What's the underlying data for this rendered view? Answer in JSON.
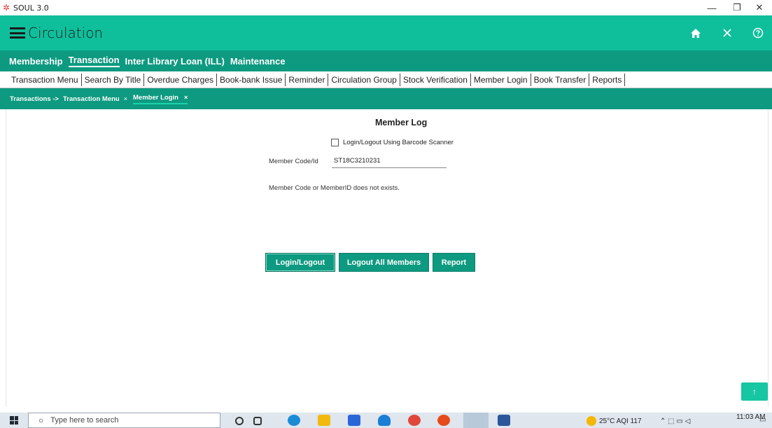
{
  "window": {
    "title": "SOUL 3.0",
    "controls": [
      "—",
      "❐",
      "✕"
    ]
  },
  "appbar": {
    "title": "Circulation",
    "icons": [
      "home-icon",
      "close-icon",
      "help-icon"
    ],
    "accent_color": "#0fbf9c"
  },
  "menubar": {
    "items": [
      "Membership",
      "Transaction",
      "Inter Library Loan (ILL)",
      "Maintenance"
    ],
    "active": "Transaction",
    "color": "#0e9a81"
  },
  "subtabs": {
    "items": [
      "Transaction Menu",
      "Search By Title",
      "Overdue Charges",
      "Book-bank Issue",
      "Reminder",
      "Circulation Group",
      "Stock Verification",
      "Member Login",
      "Book Transfer",
      "Reports"
    ]
  },
  "breadcrumb": {
    "root": "Transactions ->",
    "tabs": [
      {
        "label": "Transaction Menu",
        "close": "×"
      },
      {
        "label": "Member Login",
        "close": "×"
      }
    ]
  },
  "form": {
    "title": "Member Log",
    "scanner_checkbox_label": "Login/Logout Using Barcode Scanner",
    "scanner_checked": false,
    "member_code_label": "Member Code/Id",
    "member_code_value": "ST18C3210231",
    "message": "Member Code or MemberID does not exists."
  },
  "buttons": {
    "login_logout": "Login/Logout",
    "logout_all": "Logout All Members",
    "report": "Report"
  },
  "fab": {
    "icon": "arrow-up-icon",
    "glyph": "↑"
  },
  "taskbar": {
    "search_placeholder": "Type here to search",
    "search_glyph": "○",
    "weather": "25°C  AQI 117",
    "time": "11:03 AM"
  }
}
